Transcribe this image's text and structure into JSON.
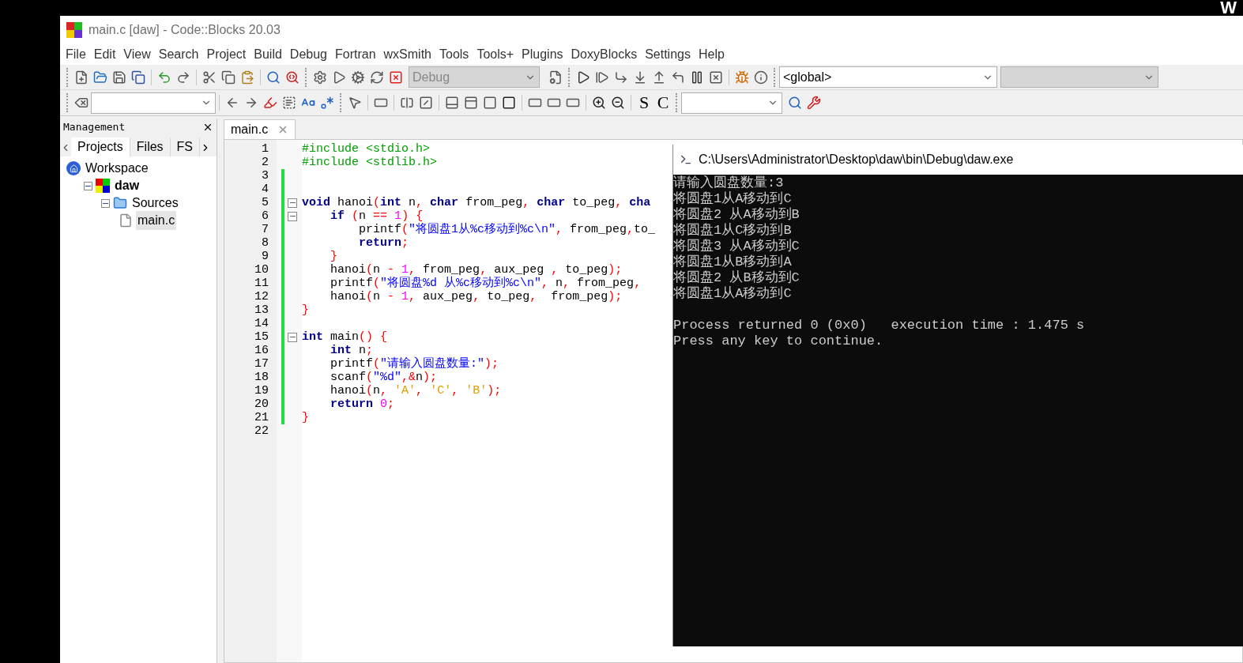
{
  "desktop": {
    "corner_text": "W"
  },
  "window": {
    "title": "main.c [daw] - Code::Blocks 20.03"
  },
  "menu": [
    "File",
    "Edit",
    "View",
    "Search",
    "Project",
    "Build",
    "Debug",
    "Fortran",
    "wxSmith",
    "Tools",
    "Tools+",
    "Plugins",
    "DoxyBlocks",
    "Settings",
    "Help"
  ],
  "toolbar": {
    "build_target": "Debug",
    "scope": "<global>",
    "text_buttons": [
      "S",
      "C"
    ]
  },
  "management": {
    "title": "Management",
    "tabs": [
      {
        "label": "Projects",
        "selected": true
      },
      {
        "label": "Files",
        "selected": false
      },
      {
        "label": "FS",
        "selected": false
      }
    ],
    "tree": [
      {
        "label": "Workspace",
        "kind": "workspace",
        "selected": false,
        "children": [
          {
            "label": "daw",
            "kind": "project",
            "active": true,
            "selected": false,
            "expanded": true,
            "children": [
              {
                "label": "Sources",
                "kind": "folder",
                "selected": false,
                "expanded": true,
                "children": [
                  {
                    "label": "main.c",
                    "kind": "file",
                    "selected": true
                  }
                ]
              }
            ]
          }
        ]
      }
    ]
  },
  "editor": {
    "tabs": [
      {
        "label": "main.c",
        "selected": true
      }
    ],
    "lines": [
      {
        "number": "1",
        "changed": false,
        "fold_start": false,
        "text": "#include <stdio.h>"
      },
      {
        "number": "2",
        "changed": false,
        "fold_start": false,
        "text": "#include <stdlib.h>"
      },
      {
        "number": "3",
        "changed": true,
        "fold_start": false
      },
      {
        "number": "4",
        "changed": true,
        "fold_start": false
      },
      {
        "number": "5",
        "changed": true,
        "fold_start": true,
        "text": "**void** hanoi(**int** n, **char** from_peg, **char** to_peg, **cha**"
      },
      {
        "number": "6",
        "changed": true,
        "fold_start": true,
        "text": "    **if** (n == 1) {"
      },
      {
        "number": "7",
        "changed": true,
        "fold_start": false,
        "text": "        printf(\"将圆盘1从%c移动到%c\\n\", from_peg,to_"
      },
      {
        "number": "8",
        "changed": true,
        "fold_start": false,
        "text": "        **return**;"
      },
      {
        "number": "9",
        "changed": true,
        "fold_start": false,
        "text": "    }"
      },
      {
        "number": "10",
        "changed": true,
        "fold_start": false,
        "text": "    hanoi(n - 1, from_peg, aux_peg , to_peg);"
      },
      {
        "number": "11",
        "changed": true,
        "fold_start": false,
        "text": "    printf(\"将圆盘%d 从%c移动到%c\\n\", n, from_peg,"
      },
      {
        "number": "12",
        "changed": true,
        "fold_start": false,
        "text": "    hanoi(n - 1, aux_peg, to_peg,  from_peg);"
      },
      {
        "number": "13",
        "changed": true,
        "fold_start": false,
        "text": "}"
      },
      {
        "number": "14",
        "changed": true,
        "fold_start": false
      },
      {
        "number": "15",
        "changed": true,
        "fold_start": true,
        "text": "**int** main() {"
      },
      {
        "number": "16",
        "changed": true,
        "fold_start": false,
        "text": "    **int** n;"
      },
      {
        "number": "17",
        "changed": true,
        "fold_start": false,
        "text": "    printf(\"请输入圆盘数量:\");"
      },
      {
        "number": "18",
        "changed": true,
        "fold_start": false,
        "text": "    scanf(\"%d\",&n);"
      },
      {
        "number": "19",
        "changed": true,
        "fold_start": false,
        "text": "    hanoi(n, 'A', 'C', 'B');"
      },
      {
        "number": "20",
        "changed": true,
        "fold_start": false,
        "text": "    **return** 0;"
      },
      {
        "number": "21",
        "changed": true,
        "fold_start": false,
        "text": "}"
      },
      {
        "number": "22",
        "changed": false,
        "fold_start": false
      }
    ]
  },
  "console": {
    "title": "C:\\Users\\Administrator\\Desktop\\daw\\bin\\Debug\\daw.exe",
    "lines": [
      "请输入圆盘数量:3",
      "将圆盘1从A移动到C",
      "将圆盘2 从A移动到B",
      "将圆盘1从C移动到B",
      "将圆盘3 从A移动到C",
      "将圆盘1从B移动到A",
      "将圆盘2 从B移动到C",
      "将圆盘1从A移动到C"
    ],
    "footer": [
      "Process returned 0 (0x0)   execution time : 1.475 s",
      "Press any key to continue."
    ]
  }
}
